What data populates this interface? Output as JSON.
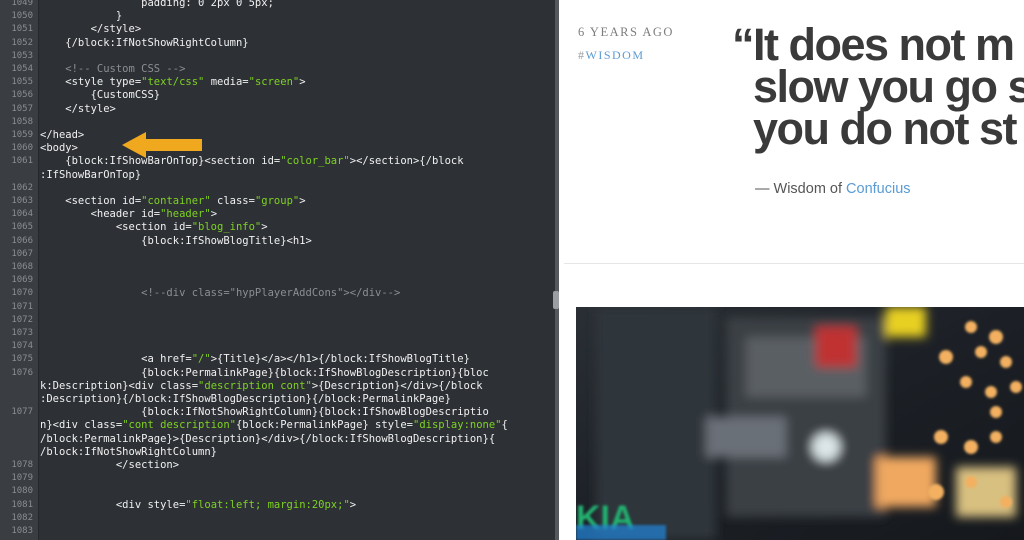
{
  "editor": {
    "lines": [
      {
        "num": "1049",
        "segs": [
          {
            "t": "                padding: 0 2px 0 5px;",
            "c": "w"
          }
        ]
      },
      {
        "num": "1050",
        "segs": [
          {
            "t": "            }",
            "c": "w"
          }
        ]
      },
      {
        "num": "1051",
        "segs": [
          {
            "t": "        </style>",
            "c": "w"
          }
        ]
      },
      {
        "num": "1052",
        "segs": [
          {
            "t": "    {/block:IfNotShowRightColumn}",
            "c": "w"
          }
        ]
      },
      {
        "num": "1053",
        "segs": []
      },
      {
        "num": "1054",
        "segs": [
          {
            "t": "    <!-- Custom CSS -->",
            "c": "c"
          }
        ]
      },
      {
        "num": "1055",
        "segs": [
          {
            "t": "    <style type=",
            "c": "w"
          },
          {
            "t": "\"text/css\"",
            "c": "g"
          },
          {
            "t": " media=",
            "c": "w"
          },
          {
            "t": "\"screen\"",
            "c": "g"
          },
          {
            "t": ">",
            "c": "w"
          }
        ]
      },
      {
        "num": "1056",
        "segs": [
          {
            "t": "        {CustomCSS}",
            "c": "w"
          }
        ]
      },
      {
        "num": "1057",
        "segs": [
          {
            "t": "    </style>",
            "c": "w"
          }
        ]
      },
      {
        "num": "1058",
        "segs": []
      },
      {
        "num": "1059",
        "segs": [
          {
            "t": "</head>",
            "c": "w"
          }
        ]
      },
      {
        "num": "1060",
        "segs": [
          {
            "t": "<body>",
            "c": "w"
          }
        ]
      },
      {
        "num": "1061",
        "segs": [
          {
            "t": "    {block:IfShowBarOnTop}<section id=",
            "c": "w"
          },
          {
            "t": "\"color_bar\"",
            "c": "g"
          },
          {
            "t": "></section>{/block",
            "c": "w"
          }
        ]
      },
      {
        "num": "",
        "segs": [
          {
            "t": ":IfShowBarOnTop}",
            "c": "w"
          }
        ]
      },
      {
        "num": "1062",
        "segs": []
      },
      {
        "num": "1063",
        "segs": [
          {
            "t": "    <section id=",
            "c": "w"
          },
          {
            "t": "\"container\"",
            "c": "g"
          },
          {
            "t": " class=",
            "c": "w"
          },
          {
            "t": "\"group\"",
            "c": "g"
          },
          {
            "t": ">",
            "c": "w"
          }
        ]
      },
      {
        "num": "1064",
        "segs": [
          {
            "t": "        <header id=",
            "c": "w"
          },
          {
            "t": "\"header\"",
            "c": "g"
          },
          {
            "t": ">",
            "c": "w"
          }
        ]
      },
      {
        "num": "1065",
        "segs": [
          {
            "t": "            <section id=",
            "c": "w"
          },
          {
            "t": "\"blog_info\"",
            "c": "g"
          },
          {
            "t": ">",
            "c": "w"
          }
        ]
      },
      {
        "num": "1066",
        "segs": [
          {
            "t": "                {block:IfShowBlogTitle}<h1>",
            "c": "w"
          }
        ]
      },
      {
        "num": "1067",
        "segs": []
      },
      {
        "num": "1068",
        "segs": []
      },
      {
        "num": "1069",
        "segs": []
      },
      {
        "num": "1070",
        "segs": [
          {
            "t": "                <!--div class=\"hypPlayerAddCons\"></div-->",
            "c": "c"
          }
        ]
      },
      {
        "num": "1071",
        "segs": []
      },
      {
        "num": "1072",
        "segs": []
      },
      {
        "num": "1073",
        "segs": []
      },
      {
        "num": "1074",
        "segs": []
      },
      {
        "num": "1075",
        "segs": [
          {
            "t": "                <a href=",
            "c": "w"
          },
          {
            "t": "\"/\"",
            "c": "g"
          },
          {
            "t": ">{Title}</a></h1>{/block:IfShowBlogTitle}",
            "c": "w"
          }
        ]
      },
      {
        "num": "1076",
        "segs": [
          {
            "t": "                {block:PermalinkPage}{block:IfShowBlogDescription}{bloc",
            "c": "w"
          }
        ]
      },
      {
        "num": "",
        "segs": [
          {
            "t": "k:Description}<div class=",
            "c": "w"
          },
          {
            "t": "\"description cont\"",
            "c": "g"
          },
          {
            "t": ">{Description}</div>{/block",
            "c": "w"
          }
        ]
      },
      {
        "num": "",
        "segs": [
          {
            "t": ":Description}{/block:IfShowBlogDescription}{/block:PermalinkPage}",
            "c": "w"
          }
        ]
      },
      {
        "num": "1077",
        "segs": [
          {
            "t": "                {block:IfNotShowRightColumn}{block:IfShowBlogDescriptio",
            "c": "w"
          }
        ]
      },
      {
        "num": "",
        "segs": [
          {
            "t": "n}<div class=",
            "c": "w"
          },
          {
            "t": "\"cont description\"",
            "c": "g"
          },
          {
            "t": "{block:PermalinkPage} style=",
            "c": "w"
          },
          {
            "t": "\"display:none\"",
            "c": "g"
          },
          {
            "t": "{",
            "c": "w"
          }
        ]
      },
      {
        "num": "",
        "segs": [
          {
            "t": "/block:PermalinkPage}>{Description}</div>{/block:IfShowBlogDescription}{",
            "c": "w"
          }
        ]
      },
      {
        "num": "",
        "segs": [
          {
            "t": "/block:IfNotShowRightColumn}",
            "c": "w"
          }
        ]
      },
      {
        "num": "1078",
        "segs": [
          {
            "t": "            </section>",
            "c": "w"
          }
        ]
      },
      {
        "num": "1079",
        "segs": []
      },
      {
        "num": "1080",
        "segs": []
      },
      {
        "num": "1081",
        "segs": [
          {
            "t": "            <div style=",
            "c": "w"
          },
          {
            "t": "\"float:left; margin:20px;\"",
            "c": "g"
          },
          {
            "t": ">",
            "c": "w"
          }
        ]
      },
      {
        "num": "1082",
        "segs": []
      },
      {
        "num": "1083",
        "segs": []
      }
    ]
  },
  "post": {
    "time_ago": "6 YEARS AGO",
    "tag_hash": "#",
    "tag_name": "WISDOM",
    "quote_lines": [
      "“It does not m",
      "slow you go s",
      "you do not st"
    ],
    "attribution_prefix": "— Wisdom of ",
    "attribution_author": "Confucius"
  },
  "photo": {
    "visible_text": "KIA",
    "colors": {
      "dark": "#1b1f24",
      "warm": "#f0a860",
      "yellow": "#e8d020",
      "sign_green": "#20b070",
      "sign_blue": "#2080d0",
      "red": "#c03030"
    }
  },
  "colors": {
    "editor_bg": "#2d3035",
    "string": "#7ed321",
    "comment": "#8b8f95",
    "arrow": "#f0a81e",
    "link": "#5a9bd4",
    "quote_text": "#3a3a3a"
  }
}
